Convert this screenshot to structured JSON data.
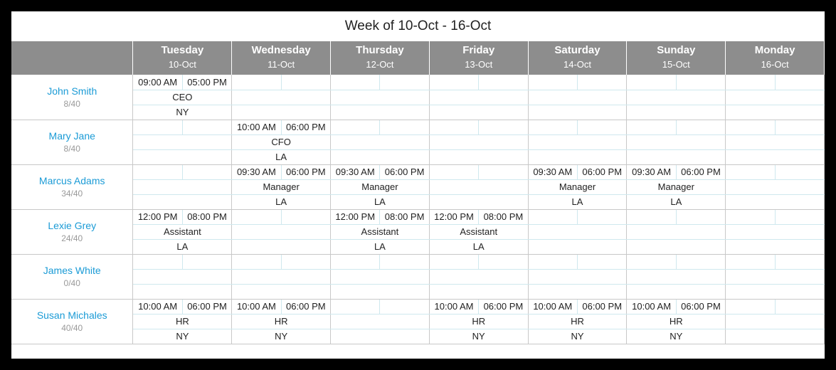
{
  "title": "Week of 10-Oct - 16-Oct",
  "days": [
    {
      "name": "Tuesday",
      "date": "10-Oct"
    },
    {
      "name": "Wednesday",
      "date": "11-Oct"
    },
    {
      "name": "Thursday",
      "date": "12-Oct"
    },
    {
      "name": "Friday",
      "date": "13-Oct"
    },
    {
      "name": "Saturday",
      "date": "14-Oct"
    },
    {
      "name": "Sunday",
      "date": "15-Oct"
    },
    {
      "name": "Monday",
      "date": "16-Oct"
    }
  ],
  "employees": [
    {
      "name": "John Smith",
      "hours": "8/40",
      "shifts": [
        {
          "start": "09:00 AM",
          "end": "05:00 PM",
          "role": "CEO",
          "loc": "NY"
        },
        null,
        null,
        null,
        null,
        null,
        null
      ]
    },
    {
      "name": "Mary Jane",
      "hours": "8/40",
      "shifts": [
        null,
        {
          "start": "10:00 AM",
          "end": "06:00 PM",
          "role": "CFO",
          "loc": "LA"
        },
        null,
        null,
        null,
        null,
        null
      ]
    },
    {
      "name": "Marcus Adams",
      "hours": "34/40",
      "shifts": [
        null,
        {
          "start": "09:30 AM",
          "end": "06:00 PM",
          "role": "Manager",
          "loc": "LA"
        },
        {
          "start": "09:30 AM",
          "end": "06:00 PM",
          "role": "Manager",
          "loc": "LA"
        },
        null,
        {
          "start": "09:30 AM",
          "end": "06:00 PM",
          "role": "Manager",
          "loc": "LA"
        },
        {
          "start": "09:30 AM",
          "end": "06:00 PM",
          "role": "Manager",
          "loc": "LA"
        },
        null
      ]
    },
    {
      "name": "Lexie Grey",
      "hours": "24/40",
      "shifts": [
        {
          "start": "12:00 PM",
          "end": "08:00 PM",
          "role": "Assistant",
          "loc": "LA"
        },
        null,
        {
          "start": "12:00 PM",
          "end": "08:00 PM",
          "role": "Assistant",
          "loc": "LA"
        },
        {
          "start": "12:00 PM",
          "end": "08:00 PM",
          "role": "Assistant",
          "loc": "LA"
        },
        null,
        null,
        null
      ]
    },
    {
      "name": "James White",
      "hours": "0/40",
      "shifts": [
        null,
        null,
        null,
        null,
        null,
        null,
        null
      ]
    },
    {
      "name": "Susan Michales",
      "hours": "40/40",
      "shifts": [
        {
          "start": "10:00 AM",
          "end": "06:00 PM",
          "role": "HR",
          "loc": "NY"
        },
        {
          "start": "10:00 AM",
          "end": "06:00 PM",
          "role": "HR",
          "loc": "NY"
        },
        null,
        {
          "start": "10:00 AM",
          "end": "06:00 PM",
          "role": "HR",
          "loc": "NY"
        },
        {
          "start": "10:00 AM",
          "end": "06:00 PM",
          "role": "HR",
          "loc": "NY"
        },
        {
          "start": "10:00 AM",
          "end": "06:00 PM",
          "role": "HR",
          "loc": "NY"
        },
        null
      ]
    }
  ]
}
